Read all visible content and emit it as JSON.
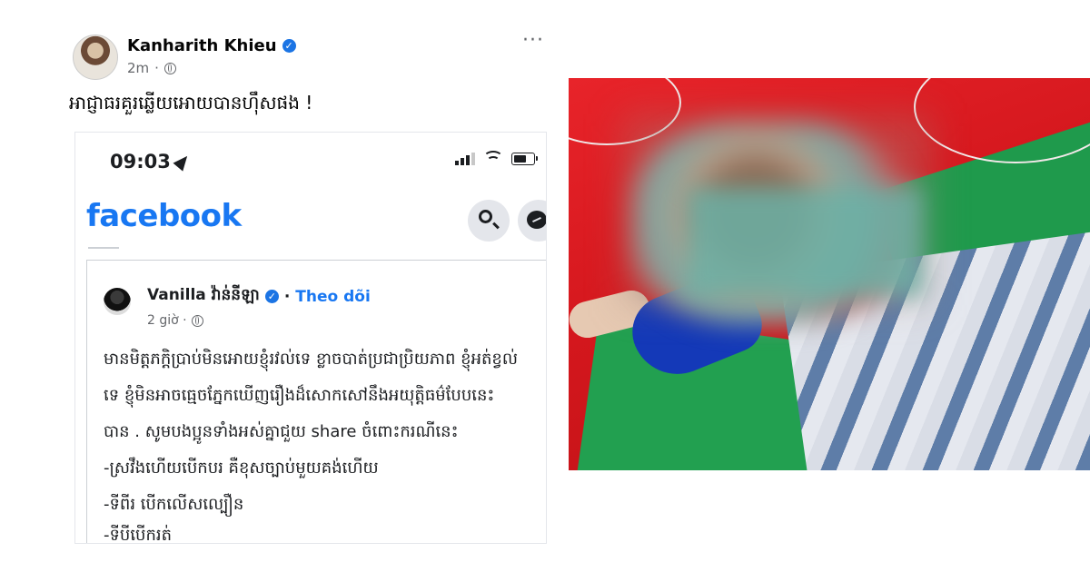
{
  "post": {
    "author": "Kanharith Khieu",
    "time": "2m",
    "more": "···",
    "text": "អាជ្ញាធរគួរឆ្លើយអោយបានហ៊ឹសផង !"
  },
  "screenshot": {
    "status_time": "09:03",
    "app_name": "facebook",
    "inner_post": {
      "author": "Vanilla វ៉ាន់នីឡា",
      "separator": "·",
      "follow": "Theo dõi",
      "time": "2 giờ ·",
      "lines": [
        "មានមិត្តភក្ដិប្រាប់មិនអោយខ្ញុំរវល់ទេ ខ្លាចបាត់ប្រជាប្រិយភាព ខ្ញុំអត់ខ្វល់",
        "ទេ ខ្ញុំមិនអាចធ្មេចភ្នែកឃើញរឿងដ៏សោកសៅនឹងអយុត្តិធម៌បែបនេះ",
        "បាន . សូមបងប្អូនទាំងអស់គ្នាជួយ share ចំពោះករណីនេះ",
        "-ស្រវឹងហើយបើកបរ គឺខុសច្បាប់មួយគង់ហើយ",
        "-ទីពីរ បើកលើសល្បឿន",
        "-ទីបីបើករត់"
      ]
    }
  },
  "icons": {
    "verified": "verified-badge-icon",
    "globe": "globe-icon",
    "location": "location-arrow-icon",
    "signal": "signal-icon",
    "wifi": "wifi-icon",
    "battery": "battery-icon",
    "search": "search-icon",
    "messenger": "messenger-icon"
  },
  "colors": {
    "facebook_blue": "#1877f2",
    "verified_blue": "#1b74e4",
    "muted_text": "#65676b"
  }
}
